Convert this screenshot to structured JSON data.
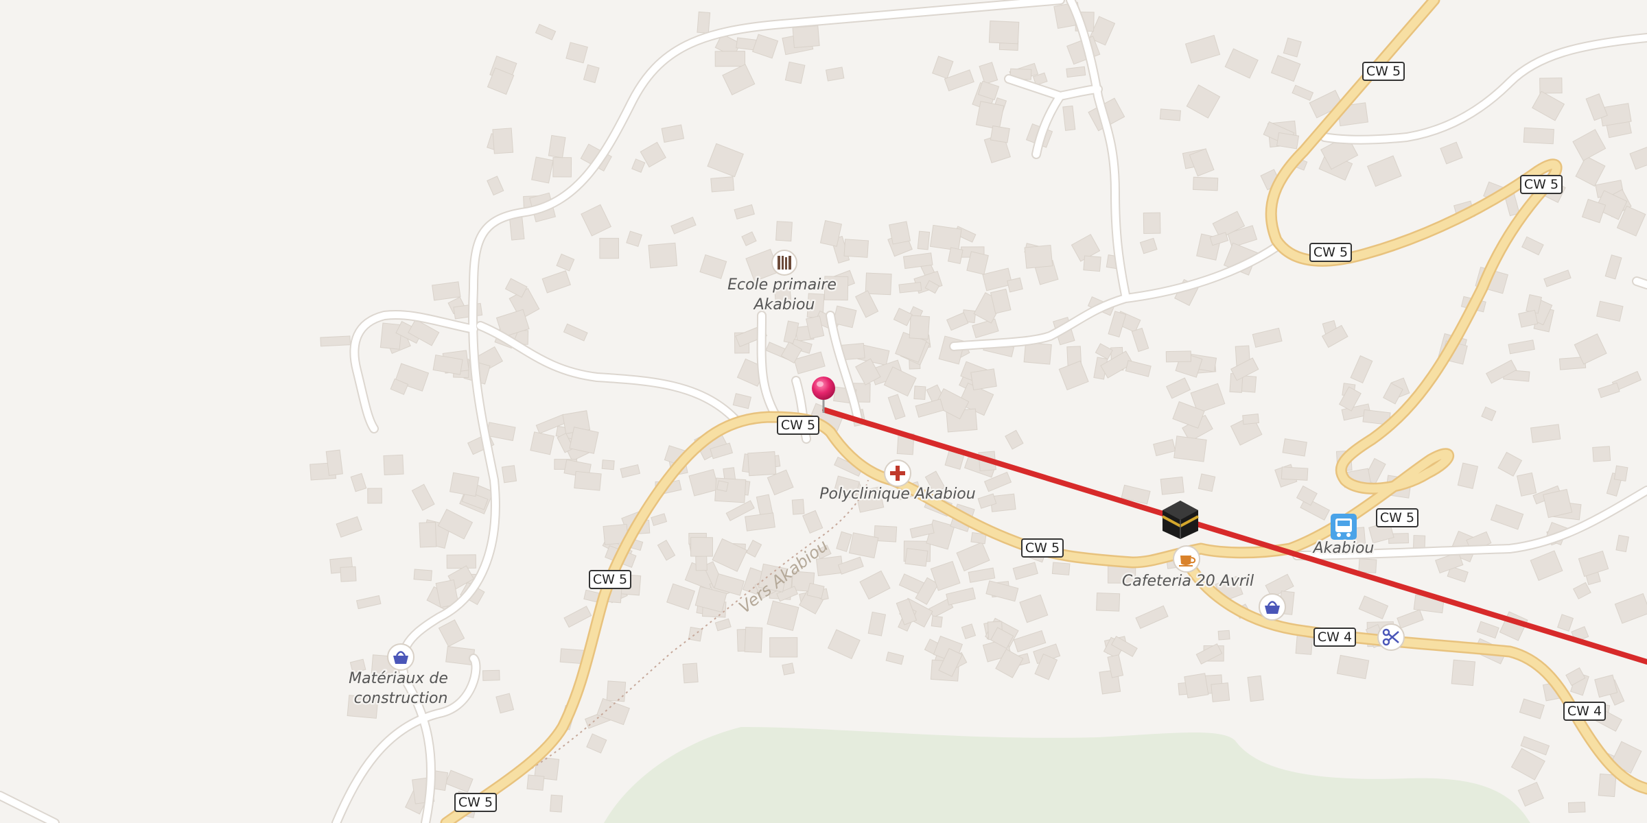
{
  "road_labels": {
    "cw5": "CW 5",
    "cw4": "CW 4"
  },
  "places": {
    "school": "Ecole primaire Akabiou",
    "clinic": "Polyclinique Akabiou",
    "cafe": "Cafeteria 20 Avril",
    "bus_stop": "Akabiou",
    "materials": "Matériaux de construction"
  },
  "footpath": {
    "name": "Vers Akabiou"
  },
  "icons": {
    "school": "school-icon",
    "clinic": "clinic-cross-icon",
    "cafe": "coffee-cup-icon",
    "bus_stop": "bus-icon",
    "shop": "shopping-basket-icon",
    "hairdresser": "scissors-icon",
    "mosque": "kaaba-icon",
    "marker": "map-pin-icon"
  },
  "colors": {
    "background": "#f5f3f0",
    "main_road": "#f7dfa3",
    "main_road_casing": "#e8c27d",
    "minor_road": "#ffffff",
    "building": "#e6e0da",
    "route_line": "#d72a2a",
    "pin": "#e6266d",
    "park": "#e5ecdd"
  }
}
